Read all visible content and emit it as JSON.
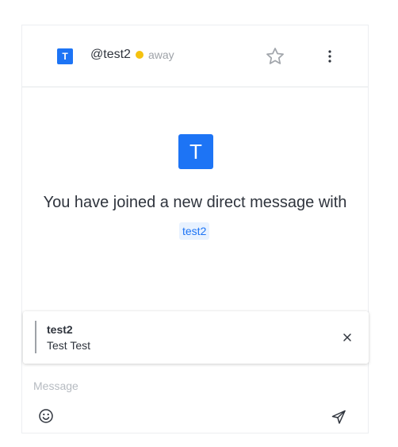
{
  "header": {
    "avatar_letter": "T",
    "at_symbol": "@",
    "username": "test2",
    "status": "away",
    "status_color": "#f5c20f"
  },
  "welcome": {
    "avatar_letter": "T",
    "message": "You have joined a new direct message with",
    "mention": "test2"
  },
  "reply": {
    "author": "test2",
    "text": "Test Test"
  },
  "composer": {
    "placeholder": "Message"
  },
  "icons": {
    "favorite": "star-icon",
    "menu": "kebab-menu-icon",
    "close": "close-icon",
    "emoji": "emoji-icon",
    "send": "send-icon"
  },
  "colors": {
    "accent": "#1d74f5",
    "mention_bg": "#e8f2ff"
  }
}
